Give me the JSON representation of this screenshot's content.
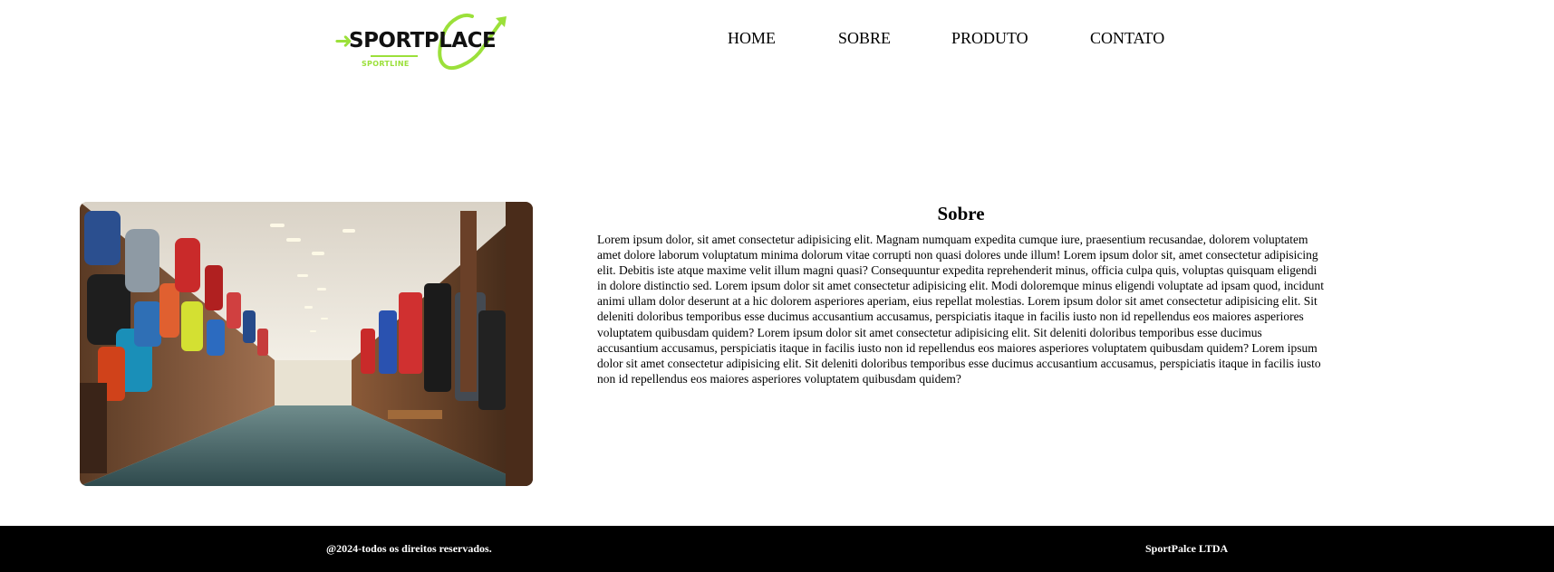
{
  "logo": {
    "name": "SPORTPLACE",
    "tagline": "SPORTLINE",
    "accent_color": "#9be03a"
  },
  "nav": {
    "items": [
      "HOME",
      "SOBRE",
      "PRODUTO",
      "CONTATO"
    ]
  },
  "about": {
    "title": "Sobre",
    "body": "Lorem ipsum dolor, sit amet consectetur adipisicing elit. Magnam numquam expedita cumque iure, praesentium recusandae, dolorem voluptatem amet dolore laborum voluptatum minima dolorum vitae corrupti non quasi dolores unde illum! Lorem ipsum dolor sit, amet consectetur adipisicing elit. Debitis iste atque maxime velit illum magni quasi? Consequuntur expedita reprehenderit minus, officia culpa quis, voluptas quisquam eligendi in dolore distinctio sed. Lorem ipsum dolor sit amet consectetur adipisicing elit. Modi doloremque minus eligendi voluptate ad ipsam quod, incidunt animi ullam dolor deserunt at a hic dolorem asperiores aperiam, eius repellat molestias. Lorem ipsum dolor sit amet consectetur adipisicing elit. Sit deleniti doloribus temporibus esse ducimus accusantium accusamus, perspiciatis itaque in facilis iusto non id repellendus eos maiores asperiores voluptatem quibusdam quidem? Lorem ipsum dolor sit amet consectetur adipisicing elit. Sit deleniti doloribus temporibus esse ducimus accusantium accusamus, perspiciatis itaque in facilis iusto non id repellendus eos maiores asperiores voluptatem quibusdam quidem? Lorem ipsum dolor sit amet consectetur adipisicing elit. Sit deleniti doloribus temporibus esse ducimus accusantium accusamus, perspiciatis itaque in facilis iusto non id repellendus eos maiores asperiores voluptatem quibusdam quidem?"
  },
  "footer": {
    "copyright": "@2024-todos os direitos reservados.",
    "company": "SportPalce LTDA",
    "background": "#000000"
  }
}
